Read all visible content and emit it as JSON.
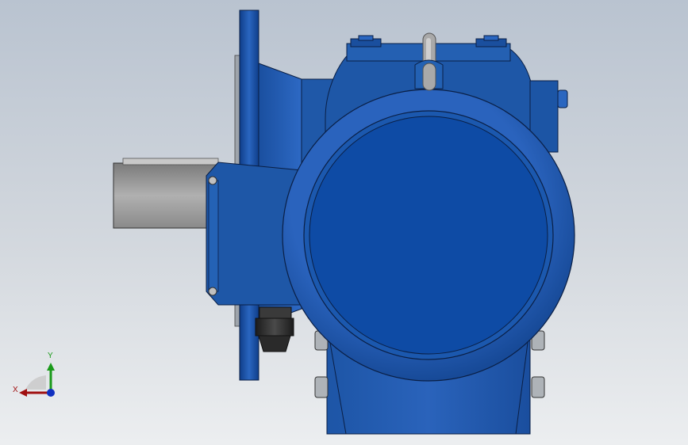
{
  "viewport": {
    "background_top": "#b9c3d0",
    "background_bottom": "#eceef0"
  },
  "model": {
    "body_color": "#1c55a5",
    "body_dark": "#0d3a80",
    "shaft_color": "#9a9a9a",
    "gland_color": "#2a2a2a",
    "lifting_eye_color": "#a9a9a9"
  },
  "triad": {
    "x_label": "X",
    "y_label": "Y",
    "x_color": "#a01010",
    "y_color": "#1a9a1a",
    "z_color": "#1030c0"
  }
}
